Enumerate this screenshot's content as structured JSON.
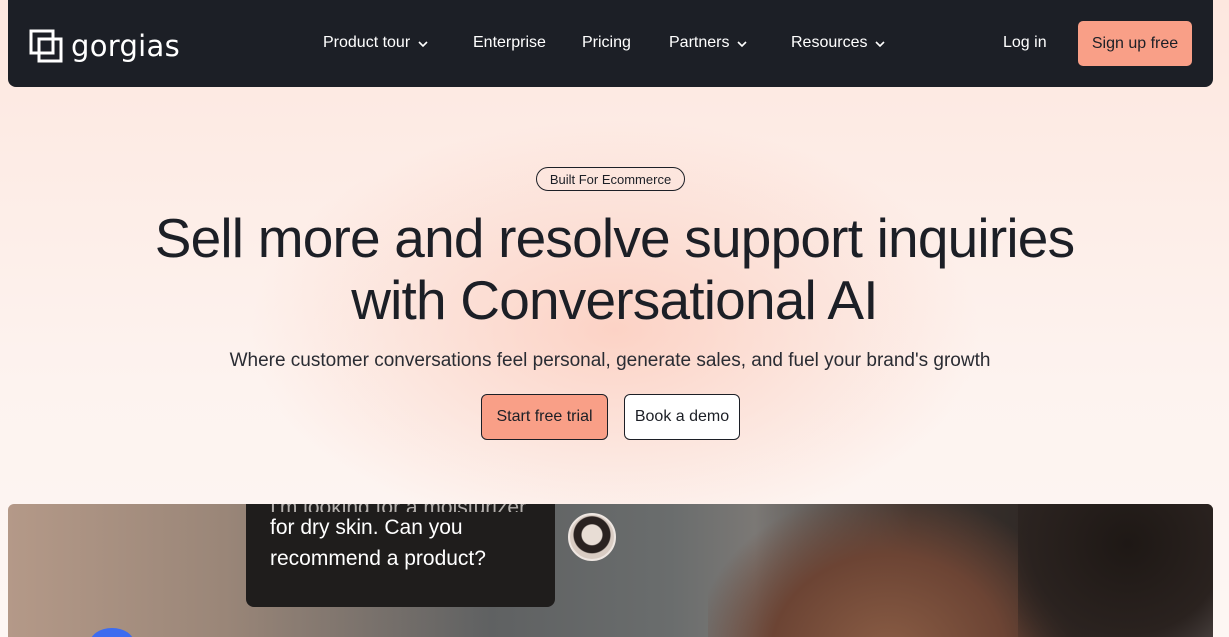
{
  "nav": {
    "logo_text": "gorgias",
    "items": [
      {
        "label": "Product tour",
        "has_dropdown": true
      },
      {
        "label": "Enterprise",
        "has_dropdown": false
      },
      {
        "label": "Pricing",
        "has_dropdown": false
      },
      {
        "label": "Partners",
        "has_dropdown": true
      },
      {
        "label": "Resources",
        "has_dropdown": true
      }
    ],
    "login_label": "Log in",
    "signup_label": "Sign up free"
  },
  "hero": {
    "badge": "Built For Ecommerce",
    "headline_line1": "Sell more and resolve support inquiries",
    "headline_line2": "with Conversational AI",
    "subhead": "Where customer conversations feel personal, generate sales, and fuel your brand's growth",
    "cta_primary": "Start free trial",
    "cta_secondary": "Book a demo"
  },
  "media": {
    "chat_cutoff": "I'm looking for a moisturizer",
    "chat_line1": "for dry skin. Can you",
    "chat_line2": "recommend a product?"
  },
  "colors": {
    "nav_bg": "#1c1f26",
    "accent": "#f99f87",
    "text": "#1c1f26"
  }
}
